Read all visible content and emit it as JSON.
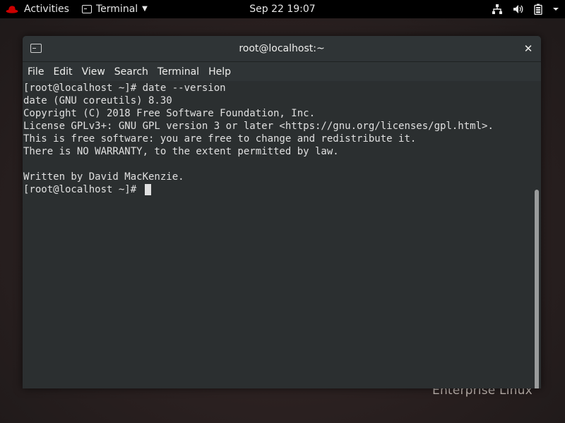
{
  "topbar": {
    "activities_label": "Activities",
    "app_menu_label": "Terminal",
    "clock": "Sep 22  19:07",
    "icons": [
      "network-icon",
      "volume-icon",
      "battery-icon",
      "system-menu-icon"
    ]
  },
  "window": {
    "title": "root@localhost:~",
    "close_glyph": "✕"
  },
  "menubar": {
    "items": [
      "File",
      "Edit",
      "View",
      "Search",
      "Terminal",
      "Help"
    ]
  },
  "terminal": {
    "lines": [
      "[root@localhost ~]# date --version",
      "date (GNU coreutils) 8.30",
      "Copyright (C) 2018 Free Software Foundation, Inc.",
      "License GPLv3+: GNU GPL version 3 or later <https://gnu.org/licenses/gpl.html>.",
      "This is free software: you are free to change and redistribute it.",
      "There is NO WARRANTY, to the extent permitted by law.",
      "",
      "Written by David MacKenzie.",
      "[root@localhost ~]# "
    ]
  },
  "desktop": {
    "watermark": "Enterprise Linux"
  },
  "colors": {
    "terminal_bg": "#2b2f30",
    "terminal_fg": "#e0e0e0",
    "topbar_bg": "#000000",
    "redhat_red": "#cc0000"
  }
}
